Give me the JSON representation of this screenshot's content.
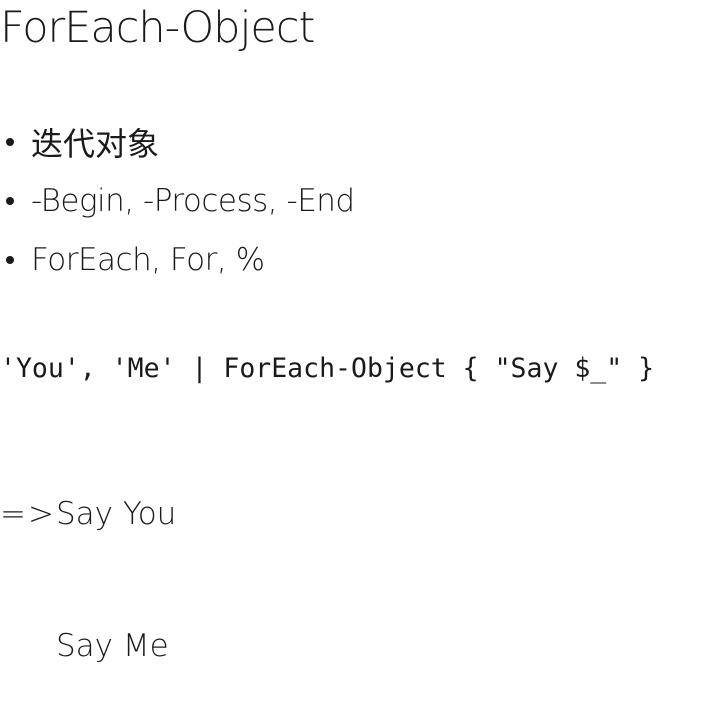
{
  "slide": {
    "title": "ForEach-Object",
    "bullets": [
      {
        "text": "迭代对象"
      },
      {
        "text": "-Begin, -Process, -End"
      },
      {
        "text": "ForEach, For, %"
      }
    ],
    "code": "'You', 'Me' | ForEach-Object { \"Say $_\" }",
    "result": {
      "arrow": "=>",
      "lines": [
        "Say You",
        "Say Me"
      ]
    }
  }
}
